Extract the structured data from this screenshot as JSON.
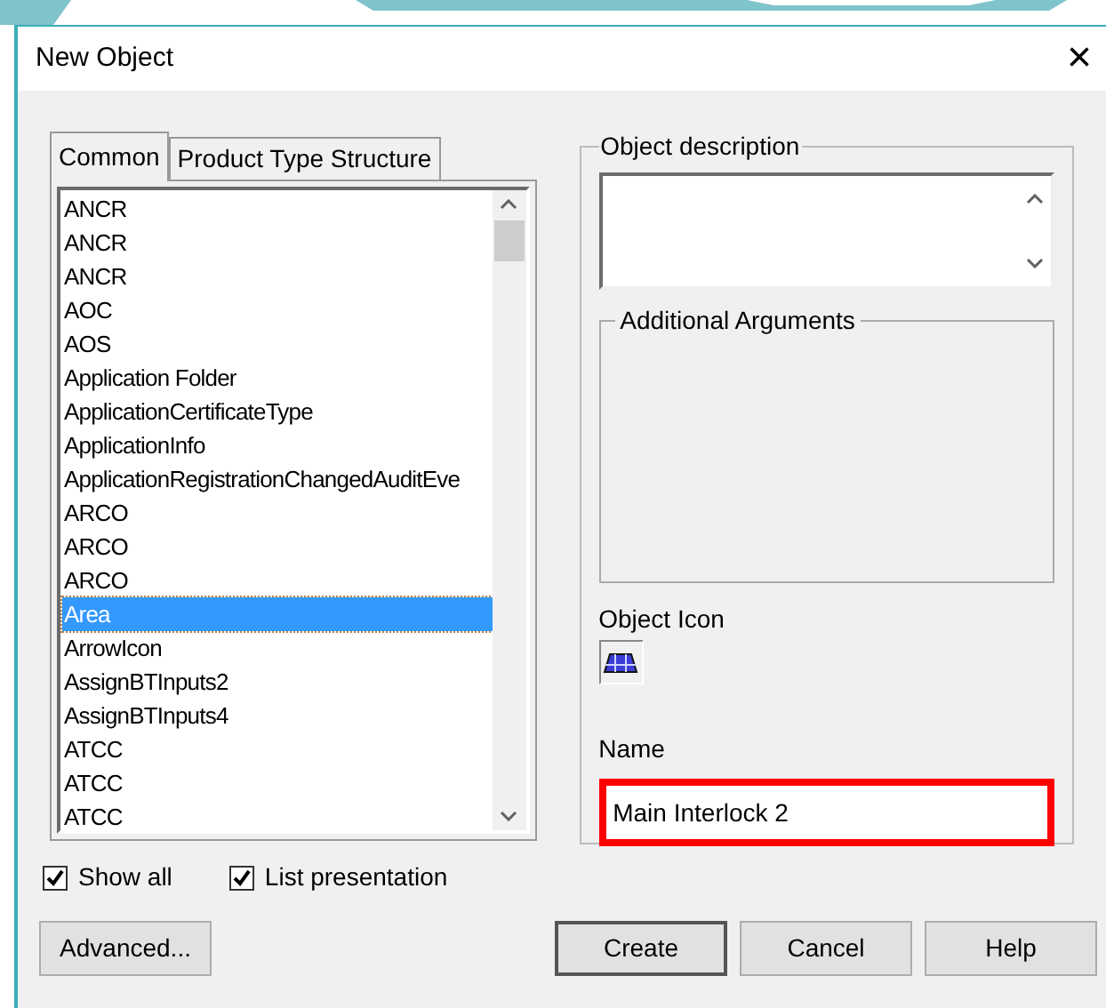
{
  "window": {
    "title": "New Object",
    "close": "×"
  },
  "tabs": [
    {
      "label": "Common",
      "selected": true
    },
    {
      "label": "Product Type Structure",
      "selected": false
    }
  ],
  "list": {
    "items": [
      {
        "label": "ANCR",
        "selected": false
      },
      {
        "label": "ANCR",
        "selected": false
      },
      {
        "label": "ANCR",
        "selected": false
      },
      {
        "label": "AOC",
        "selected": false
      },
      {
        "label": "AOS",
        "selected": false
      },
      {
        "label": "Application Folder",
        "selected": false
      },
      {
        "label": "ApplicationCertificateType",
        "selected": false
      },
      {
        "label": "ApplicationInfo",
        "selected": false
      },
      {
        "label": "ApplicationRegistrationChangedAuditEve",
        "selected": false
      },
      {
        "label": "ARCO",
        "selected": false
      },
      {
        "label": "ARCO",
        "selected": false
      },
      {
        "label": "ARCO",
        "selected": false
      },
      {
        "label": "Area",
        "selected": true
      },
      {
        "label": "ArrowIcon",
        "selected": false
      },
      {
        "label": "AssignBTInputs2",
        "selected": false
      },
      {
        "label": "AssignBTInputs4",
        "selected": false
      },
      {
        "label": "ATCC",
        "selected": false
      },
      {
        "label": "ATCC",
        "selected": false
      },
      {
        "label": "ATCC",
        "selected": false
      }
    ]
  },
  "object_description": {
    "label": "Object description"
  },
  "additional_arguments": {
    "label": "Additional Arguments"
  },
  "object_icon": {
    "label": "Object Icon"
  },
  "name": {
    "label": "Name",
    "value": "Main Interlock 2",
    "highlighted": true
  },
  "checkboxes": [
    {
      "label": "Show all",
      "checked": true
    },
    {
      "label": "List presentation",
      "checked": true
    }
  ],
  "buttons": [
    {
      "label": "Advanced...",
      "default": false
    },
    {
      "label": "Create",
      "default": true
    },
    {
      "label": "Cancel",
      "default": false
    },
    {
      "label": "Help",
      "default": false
    }
  ]
}
